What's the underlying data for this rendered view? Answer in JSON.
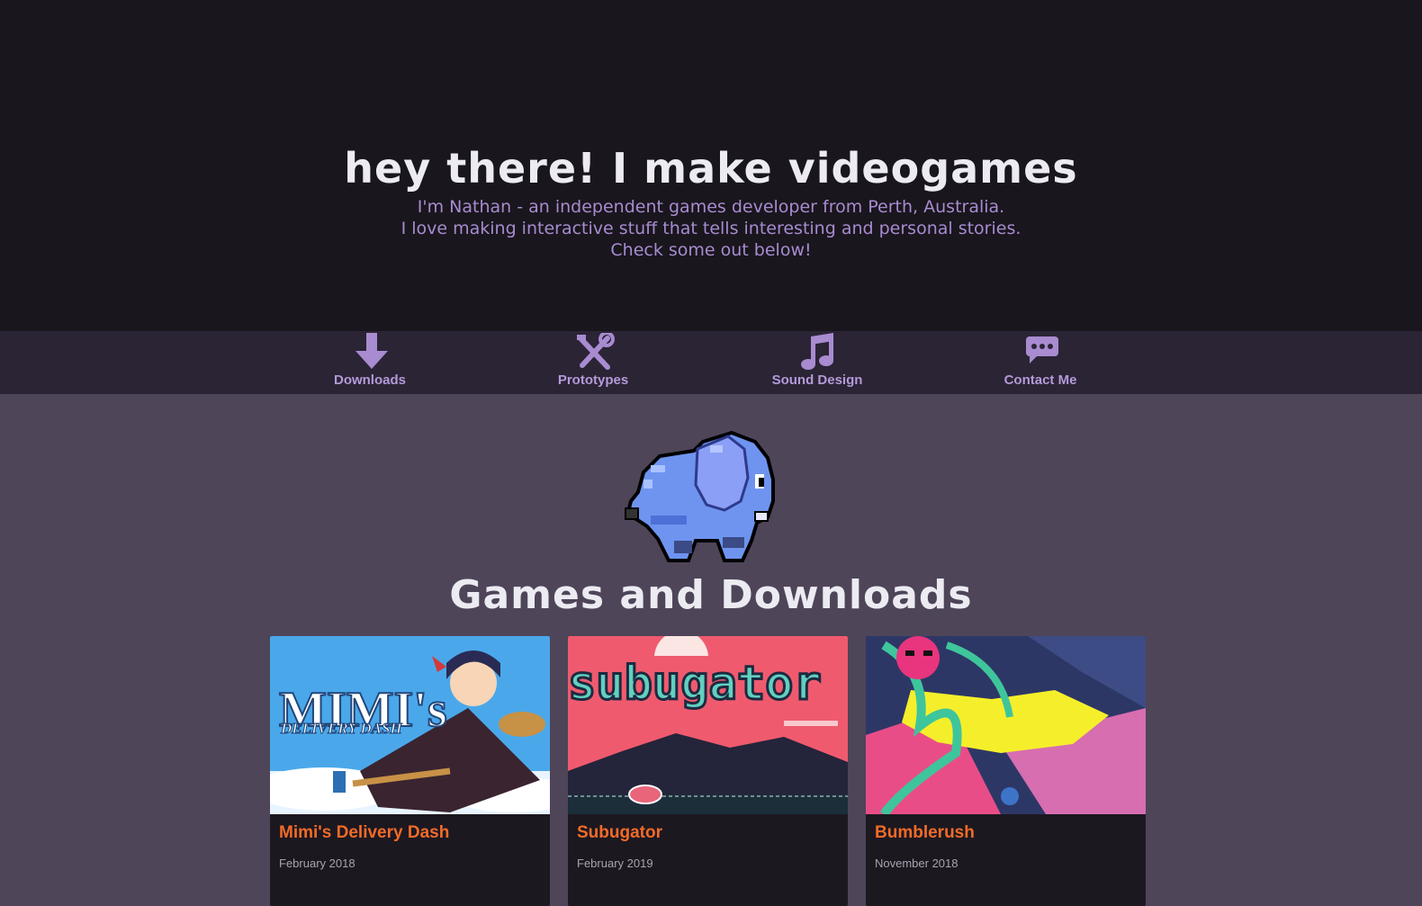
{
  "hero": {
    "title": "hey there! I make videogames",
    "lines": [
      "I'm Nathan - an independent games developer from Perth, Australia.",
      "I love making interactive stuff that tells interesting and personal stories.",
      "Check some out below!"
    ]
  },
  "nav": {
    "items": [
      {
        "label": "Downloads",
        "icon": "download-arrow-icon"
      },
      {
        "label": "Prototypes",
        "icon": "tools-icon"
      },
      {
        "label": "Sound Design",
        "icon": "music-note-icon"
      },
      {
        "label": "Contact Me",
        "icon": "chat-bubble-icon"
      }
    ]
  },
  "mascot": {
    "icon": "pixel-elephant-icon"
  },
  "section": {
    "title": "Games and Downloads"
  },
  "games": [
    {
      "title": "Mimi's Delivery Dash",
      "date": "February 2018",
      "thumb_text": "MIMI's",
      "thumb_subtext": "DELIVERY DASH"
    },
    {
      "title": "Subugator",
      "date": "February 2019",
      "thumb_text": "subugator"
    },
    {
      "title": "Bumblerush",
      "date": "November 2018"
    }
  ],
  "colors": {
    "hero_bg": "#19161d",
    "nav_bg": "#2a2435",
    "body_bg": "#4e4559",
    "accent_purple": "#a88bd0",
    "card_title": "#f26b28"
  }
}
